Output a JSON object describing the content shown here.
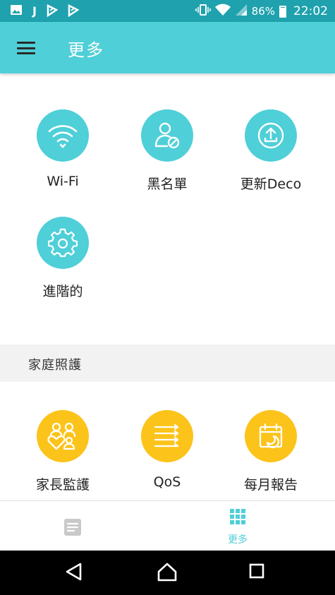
{
  "status_bar": {
    "left_icons": [
      "image-icon",
      "j-icon",
      "flag-icon",
      "flag-icon"
    ],
    "battery": "86%",
    "time": "22:02"
  },
  "app_bar": {
    "title": "更多"
  },
  "grid": [
    {
      "label": "Wi-Fi",
      "icon": "wifi-icon"
    },
    {
      "label": "黑名單",
      "icon": "blocked-user-icon"
    },
    {
      "label": "更新Deco",
      "icon": "upload-icon"
    },
    {
      "label": "進階的",
      "icon": "gear-icon"
    }
  ],
  "section": {
    "title": "家庭照護"
  },
  "family_grid": [
    {
      "label": "家長監護",
      "icon": "parental-control-icon"
    },
    {
      "label": "QoS",
      "icon": "qos-icon"
    },
    {
      "label": "每月報告",
      "icon": "calendar-report-icon"
    }
  ],
  "bottom_nav": {
    "more_label": "更多"
  },
  "colors": {
    "accent": "#4fcfd8",
    "yellow": "#fcc31a",
    "status_bar": "#1fa2ad"
  }
}
